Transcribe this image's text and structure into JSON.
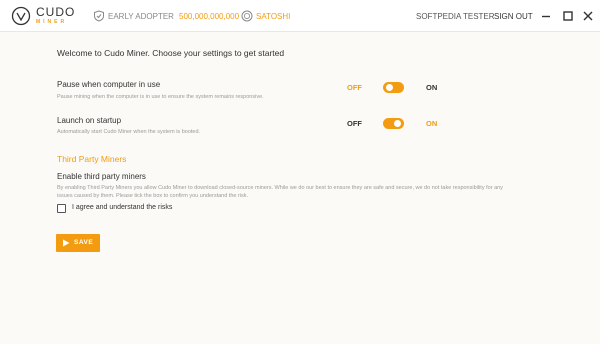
{
  "header": {
    "logo_name": "CUDO",
    "logo_sub": "MINER",
    "badge_label": "EARLY ADOPTER",
    "balance_value": "500,000,000,000",
    "currency_label": "SATOSHI",
    "user_name": "SOFTPEDIA TESTER",
    "sign_out_label": "SIGN OUT"
  },
  "main": {
    "welcome": "Welcome to Cudo Miner. Choose your settings to get started",
    "pause": {
      "title": "Pause when computer in use",
      "description": "Pause mining when the computer is in use to ensure the system remains responsive.",
      "off_label": "OFF",
      "on_label": "ON",
      "state": "off"
    },
    "launch": {
      "title": "Launch on startup",
      "description": "Automatically start Cudo Miner when the system is booted.",
      "off_label": "OFF",
      "on_label": "ON",
      "state": "on"
    },
    "third_party": {
      "heading": "Third Party Miners",
      "enable_label": "Enable third party miners",
      "description_line1": "By enabling Third Party Miners you allow Cudo Miner to download closed-source miners. While we do our best to ensure they are safe and secure, we do not take responsibility for any",
      "description_line2": "issues caused by them. Please tick the box to confirm you understand the risk.",
      "checkbox_label": "I agree and understand the risks",
      "checked": false
    },
    "save_label": "SAVE"
  },
  "colors": {
    "accent": "#f39c12",
    "background": "#fbfaf7",
    "text": "#333333"
  },
  "icons": [
    "cudo-logo-icon",
    "shield-icon",
    "coin-icon",
    "minimize-icon",
    "maximize-icon",
    "close-icon",
    "play-icon"
  ]
}
